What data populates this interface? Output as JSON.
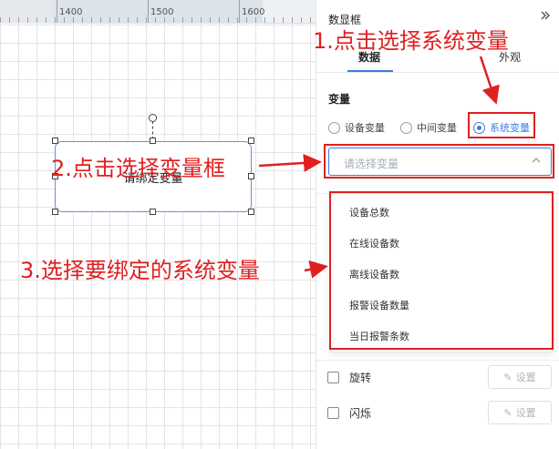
{
  "ruler": {
    "labels": [
      "1400",
      "1500",
      "1600"
    ]
  },
  "canvas": {
    "widget_text": "请绑定变量"
  },
  "panel": {
    "title": "数显框",
    "tabs": [
      {
        "label": "数据",
        "active": true
      },
      {
        "label": "外观",
        "active": false
      }
    ],
    "variable_section_label": "变量",
    "radio_options": [
      {
        "label": "设备变量",
        "checked": false
      },
      {
        "label": "中间变量",
        "checked": false
      },
      {
        "label": "系统变量",
        "checked": true
      }
    ],
    "select": {
      "placeholder": "请选择变量"
    },
    "dropdown_options": [
      "设备总数",
      "在线设备数",
      "离线设备数",
      "报警设备数量",
      "当日报警条数"
    ],
    "effects": [
      {
        "label": "旋转",
        "button_label": "设置"
      },
      {
        "label": "闪烁",
        "button_label": "设置"
      }
    ]
  },
  "annotations": {
    "step1": "1.点击选择系统变量",
    "step2": "2.点击选择变量框",
    "step3": "3.选择要绑定的系统变量"
  },
  "colors": {
    "accent": "#3f7be0",
    "annotation": "#e02020"
  }
}
